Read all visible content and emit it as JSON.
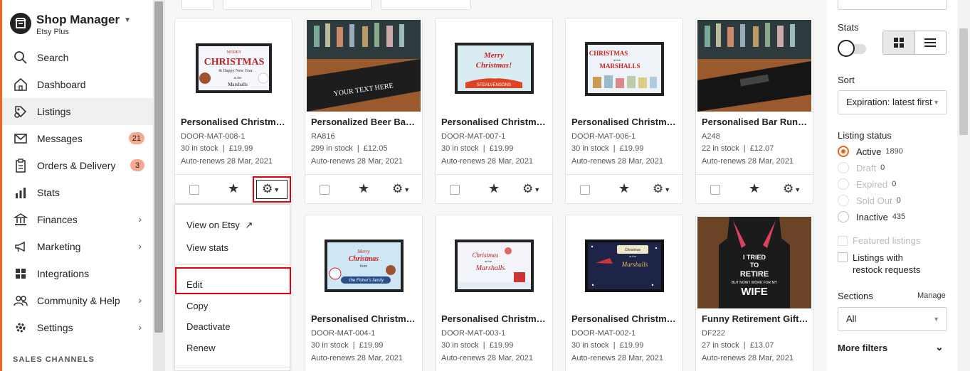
{
  "sidebar": {
    "shop_name": "Shop Manager",
    "plan": "Etsy Plus",
    "items": [
      {
        "label": "Search",
        "icon": "search-icon"
      },
      {
        "label": "Dashboard",
        "icon": "home-icon"
      },
      {
        "label": "Listings",
        "icon": "listings-icon",
        "active": true
      },
      {
        "label": "Messages",
        "icon": "mail-icon",
        "badge": "21"
      },
      {
        "label": "Orders & Delivery",
        "icon": "clipboard-icon",
        "badge": "3"
      },
      {
        "label": "Stats",
        "icon": "bar-chart-icon"
      },
      {
        "label": "Finances",
        "icon": "bank-icon",
        "chevron": true
      },
      {
        "label": "Marketing",
        "icon": "megaphone-icon",
        "chevron": true
      },
      {
        "label": "Integrations",
        "icon": "grid-icon"
      },
      {
        "label": "Community & Help",
        "icon": "people-icon",
        "chevron": true
      },
      {
        "label": "Settings",
        "icon": "gear-icon",
        "chevron": true
      }
    ],
    "channels_label": "SALES CHANNELS"
  },
  "listings": [
    {
      "title": "Personalised Christmas Door Mat",
      "sku": "DOOR-MAT-008-1",
      "stock": "30 in stock",
      "price": "£19.99",
      "renew": "Auto-renews 28 Mar, 2021"
    },
    {
      "title": "Personalized Beer Bar Runner",
      "sku": "RA816",
      "stock": "299 in stock",
      "price": "£12.05",
      "renew": "Auto-renews 28 Mar, 2021"
    },
    {
      "title": "Personalised Christmas Door Mat",
      "sku": "DOOR-MAT-007-1",
      "stock": "30 in stock",
      "price": "£19.99",
      "renew": "Auto-renews 28 Mar, 2021"
    },
    {
      "title": "Personalised Christmas Door Mat",
      "sku": "DOOR-MAT-006-1",
      "stock": "30 in stock",
      "price": "£19.99",
      "renew": "Auto-renews 28 Mar, 2021"
    },
    {
      "title": "Personalised Bar Runner",
      "sku": "A248",
      "stock": "22 in stock",
      "price": "£12.07",
      "renew": "Auto-renews 28 Mar, 2021"
    },
    {
      "title": "Personalised Christmas Door Mat",
      "sku": "DOOR-MAT-004-1",
      "stock": "30 in stock",
      "price": "£19.99",
      "renew": "Auto-renews 28 Mar, 2021"
    },
    {
      "title": "Personalised Christmas Door Mat",
      "sku": "DOOR-MAT-003-1",
      "stock": "30 in stock",
      "price": "£19.99",
      "renew": "Auto-renews 28 Mar, 2021"
    },
    {
      "title": "Personalised Christmas Door Mat",
      "sku": "DOOR-MAT-002-1",
      "stock": "30 in stock",
      "price": "£19.99",
      "renew": "Auto-renews 28 Mar, 2021"
    },
    {
      "title": "Funny Retirement Gift Apron",
      "sku": "DF222",
      "stock": "27 in stock",
      "price": "£13.07",
      "renew": "Auto-renews 28 Mar, 2021"
    }
  ],
  "image_text": {
    "mat1": [
      "MERRY",
      "CHRISTMAS",
      "& Happy New Year",
      "at the",
      "Marshalls"
    ],
    "runner1": "YOUR TEXT HERE",
    "mat2": [
      "Merry",
      "Christmas!",
      "THE",
      "STEALVENSONS"
    ],
    "mat3": [
      "CHRISTMAS",
      "at the",
      "MARSHALLS"
    ],
    "mat4": [
      "Merry",
      "Christmas",
      "from",
      "the Fisher's family"
    ],
    "mat5": [
      "Christmas",
      "at the",
      "Marshalls"
    ],
    "mat6": [
      "Christmas",
      "at the",
      "Marshalls"
    ],
    "apron": [
      "I TRIED",
      "TO",
      "RETIRE",
      "BUT NOW I WORK FOR MY",
      "WIFE"
    ]
  },
  "menu": {
    "view_on_etsy": "View on Etsy",
    "view_stats": "View stats",
    "edit": "Edit",
    "copy": "Copy",
    "deactivate": "Deactivate",
    "renew": "Renew"
  },
  "panel": {
    "stats_label": "Stats",
    "sort_label": "Sort",
    "sort_value": "Expiration: latest first",
    "status_label": "Listing status",
    "statuses": [
      {
        "label": "Active",
        "count": "1890",
        "selected": true
      },
      {
        "label": "Draft",
        "count": "0"
      },
      {
        "label": "Expired",
        "count": "0"
      },
      {
        "label": "Sold Out",
        "count": "0"
      },
      {
        "label": "Inactive",
        "count": "435"
      }
    ],
    "featured": "Featured listings",
    "restock_line1": "Listings with",
    "restock_line2": "restock requests",
    "sections_label": "Sections",
    "manage": "Manage",
    "sections_value": "All",
    "more_filters": "More filters"
  },
  "colors": {
    "accent": "#f1641e",
    "highlight": "#e0000f"
  }
}
